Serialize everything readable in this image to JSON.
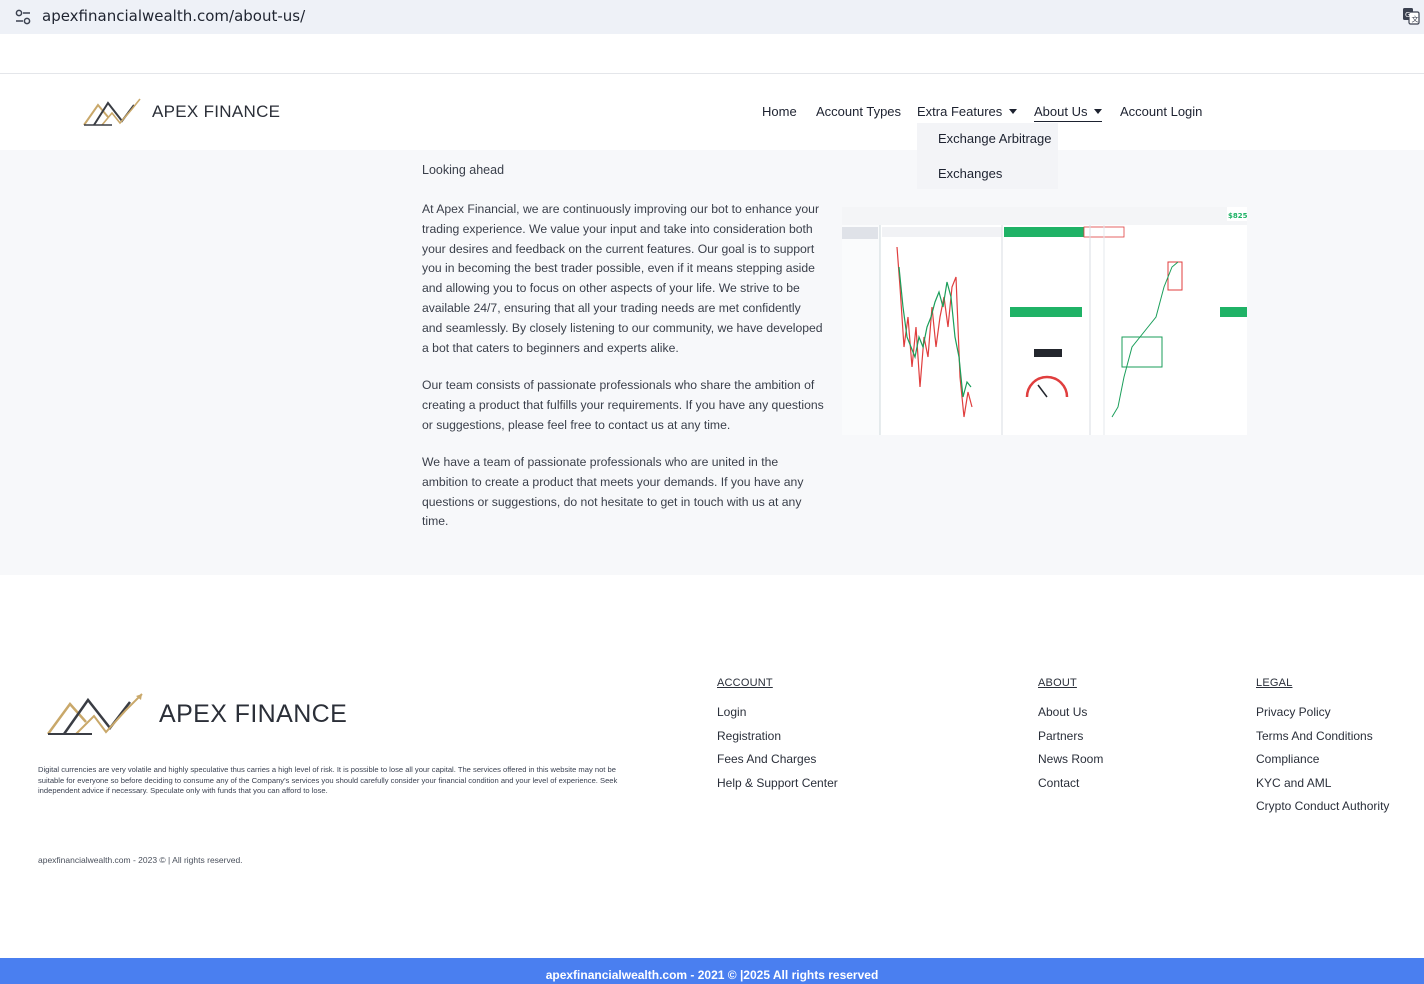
{
  "browser": {
    "url": "apexfinancialwealth.com/about-us/"
  },
  "header": {
    "brand": "APEX FINANCE",
    "nav": {
      "home": "Home",
      "account_types": "Account Types",
      "extra_features": "Extra Features",
      "about_us": "About Us",
      "account_login": "Account Login"
    },
    "dropdown": {
      "items": [
        "Exchange Arbitrage",
        "Exchanges"
      ]
    }
  },
  "main": {
    "heading": "Looking ahead",
    "paragraphs": [
      "At Apex Financial, we are continuously improving our bot to enhance your trading experience. We value your input and take into consideration both your desires and feedback on the current features. Our goal is to support you in becoming the best trader possible, even if it means stepping aside and allowing you to focus on other aspects of your life. We strive to be available 24/7, ensuring that all your trading needs are met confidently and seamlessly. By closely listening to our community, we have developed a bot that caters to beginners and experts alike.",
      "Our team consists of passionate professionals who share the ambition of creating a product that fulfills your requirements. If you have any questions or suggestions, please feel free to contact us at any time.",
      "We have a team of passionate professionals who are united in the ambition to create a product that meets your demands. If you have any questions or suggestions, do not hesitate to get in touch with us at any time."
    ]
  },
  "footer": {
    "brand": "APEX FINANCE",
    "disclaimer": "Digital currencies are very volatile and highly speculative thus carries a high level of risk. It is possible to lose all your capital. The services offered in this website may not be suitable for everyone so before deciding to consume any of the Company's services you should carefully consider your financial condition and your level of experience. Seek independent advice if necessary. Speculate only with funds that you can afford to lose.",
    "copyright_small": "apexfinancialwealth.com - 2023 © | All rights reserved.",
    "columns": {
      "account": {
        "title": "ACCOUNT",
        "links": [
          "Login",
          "Registration",
          "Fees And Charges",
          "Help & Support Center"
        ]
      },
      "about": {
        "title": "ABOUT",
        "links": [
          "About Us",
          "Partners",
          "News Room",
          "Contact"
        ]
      },
      "legal": {
        "title": "LEGAL",
        "links": [
          "Privacy Policy",
          "Terms And Conditions",
          "Compliance",
          "KYC and AML",
          "Crypto Conduct Authority"
        ]
      }
    },
    "bottom_bar": "apexfinancialwealth.com - 2021 © |2025 All rights reserved"
  },
  "colors": {
    "bottom_bar": "#4a7ff0",
    "logo_gold": "#c9a86a",
    "logo_dark": "#3a3d44"
  }
}
